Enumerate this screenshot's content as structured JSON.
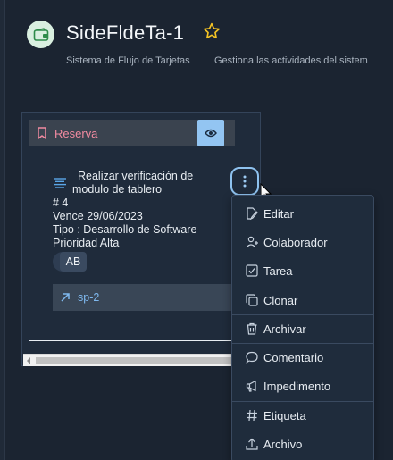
{
  "header": {
    "title": "SideFldeTa-1",
    "subtitle_left": "Sistema de Flujo de Tarjetas",
    "subtitle_right": "Gestiona las actividades del sistem",
    "icon": "wallet-icon",
    "favorite_icon": "star-icon"
  },
  "colors": {
    "background": "#1b2431",
    "accent": "#8ec2ef",
    "star": "#f4c324",
    "column_title": "#f08aa0",
    "link": "#7fb8ee"
  },
  "column": {
    "title": "Reserva",
    "title_icon": "bookmark-icon",
    "view_icon": "eye-icon"
  },
  "card": {
    "title_line1": "Realizar verificación de",
    "title_line2": "modulo de tablero",
    "number": "# 4",
    "due": "Vence 29/06/2023",
    "type": "Tipo : Desarrollo de Software",
    "priority": "Prioridad Alta",
    "assignee": "AB",
    "link": "sp-2",
    "menu_icon": "kebab-icon"
  },
  "menu": {
    "items": [
      {
        "label": "Editar",
        "icon": "edit-icon"
      },
      {
        "label": "Colaborador",
        "icon": "user-add-icon"
      },
      {
        "label": "Tarea",
        "icon": "checkbox-icon"
      },
      {
        "label": "Clonar",
        "icon": "copy-icon"
      },
      {
        "label": "Archivar",
        "icon": "trash-icon"
      },
      {
        "label": "Comentario",
        "icon": "comment-icon"
      },
      {
        "label": "Impedimento",
        "icon": "megaphone-icon"
      },
      {
        "label": "Etiqueta",
        "icon": "hash-icon"
      },
      {
        "label": "Archivo",
        "icon": "upload-icon"
      }
    ]
  }
}
